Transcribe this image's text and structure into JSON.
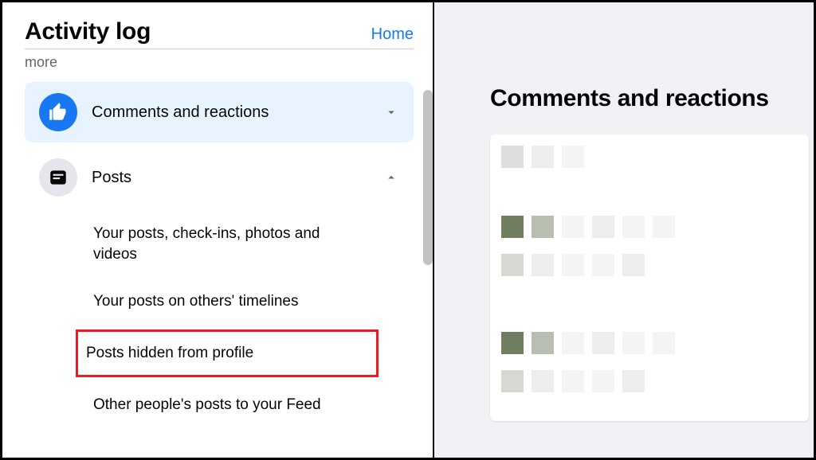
{
  "header": {
    "title": "Activity log",
    "home_link": "Home",
    "more_label": "more"
  },
  "sidebar": {
    "comments_reactions": {
      "label": "Comments and reactions",
      "expanded": false
    },
    "posts": {
      "label": "Posts",
      "expanded": true,
      "children": [
        "Your posts, check-ins, photos and videos",
        "Your posts on others' timelines",
        "Posts hidden from profile",
        "Other people's posts to your Feed"
      ],
      "highlighted_index": 2
    }
  },
  "content": {
    "title": "Comments and reactions"
  }
}
